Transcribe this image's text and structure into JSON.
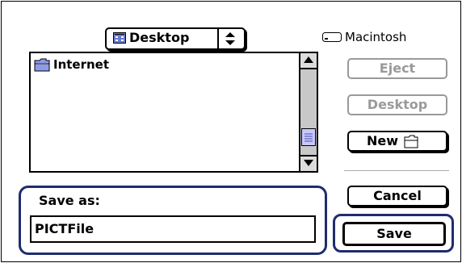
{
  "location_popup": {
    "selected": "Desktop",
    "icon": "desktop-icon"
  },
  "volume": {
    "label": "Macintosh",
    "icon": "hard-drive-icon"
  },
  "file_list": {
    "items": [
      {
        "label": "Internet",
        "icon": "folder-icon"
      }
    ],
    "scroll_position": 0.85
  },
  "buttons": {
    "eject": "Eject",
    "desktop": "Desktop",
    "new": "New",
    "cancel": "Cancel",
    "save": "Save"
  },
  "save_as": {
    "label": "Save as:",
    "value": "PICTFile"
  },
  "colors": {
    "focus_ring": "#1f2c6e",
    "disabled_text": "#9a9a9a",
    "scroll_thumb": "#c8c8ff"
  }
}
